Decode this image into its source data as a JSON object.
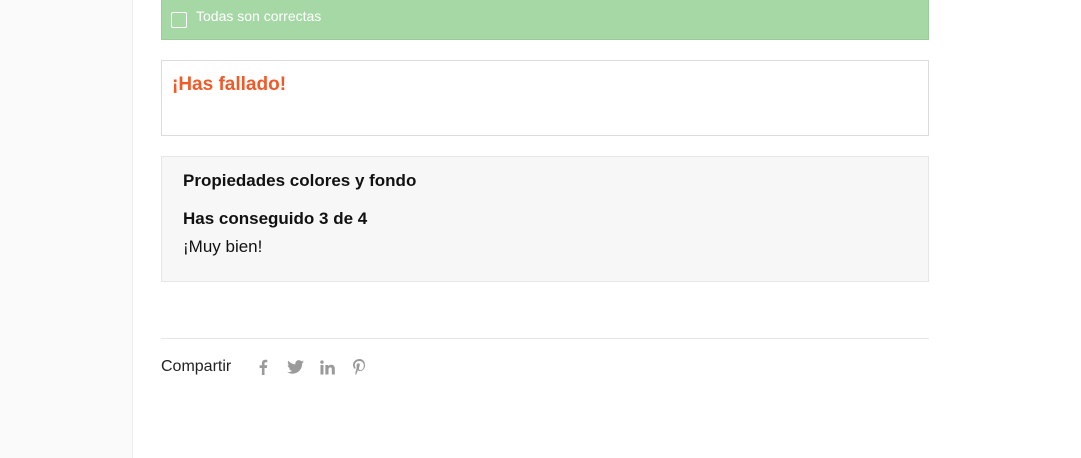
{
  "answer_option": {
    "label": "Todas son correctas",
    "checked": false,
    "state_color": "#a6d8a6"
  },
  "feedback": {
    "message": "¡Has fallado!",
    "color": "#f05a28"
  },
  "result": {
    "quiz_title": "Propiedades colores y fondo",
    "score": "Has conseguido 3 de 4",
    "message": "¡Muy bien!"
  },
  "share": {
    "label": "Compartir",
    "icons": [
      "facebook-icon",
      "twitter-icon",
      "linkedin-icon",
      "pinterest-icon"
    ],
    "icon_color": "#9a9a9a"
  }
}
